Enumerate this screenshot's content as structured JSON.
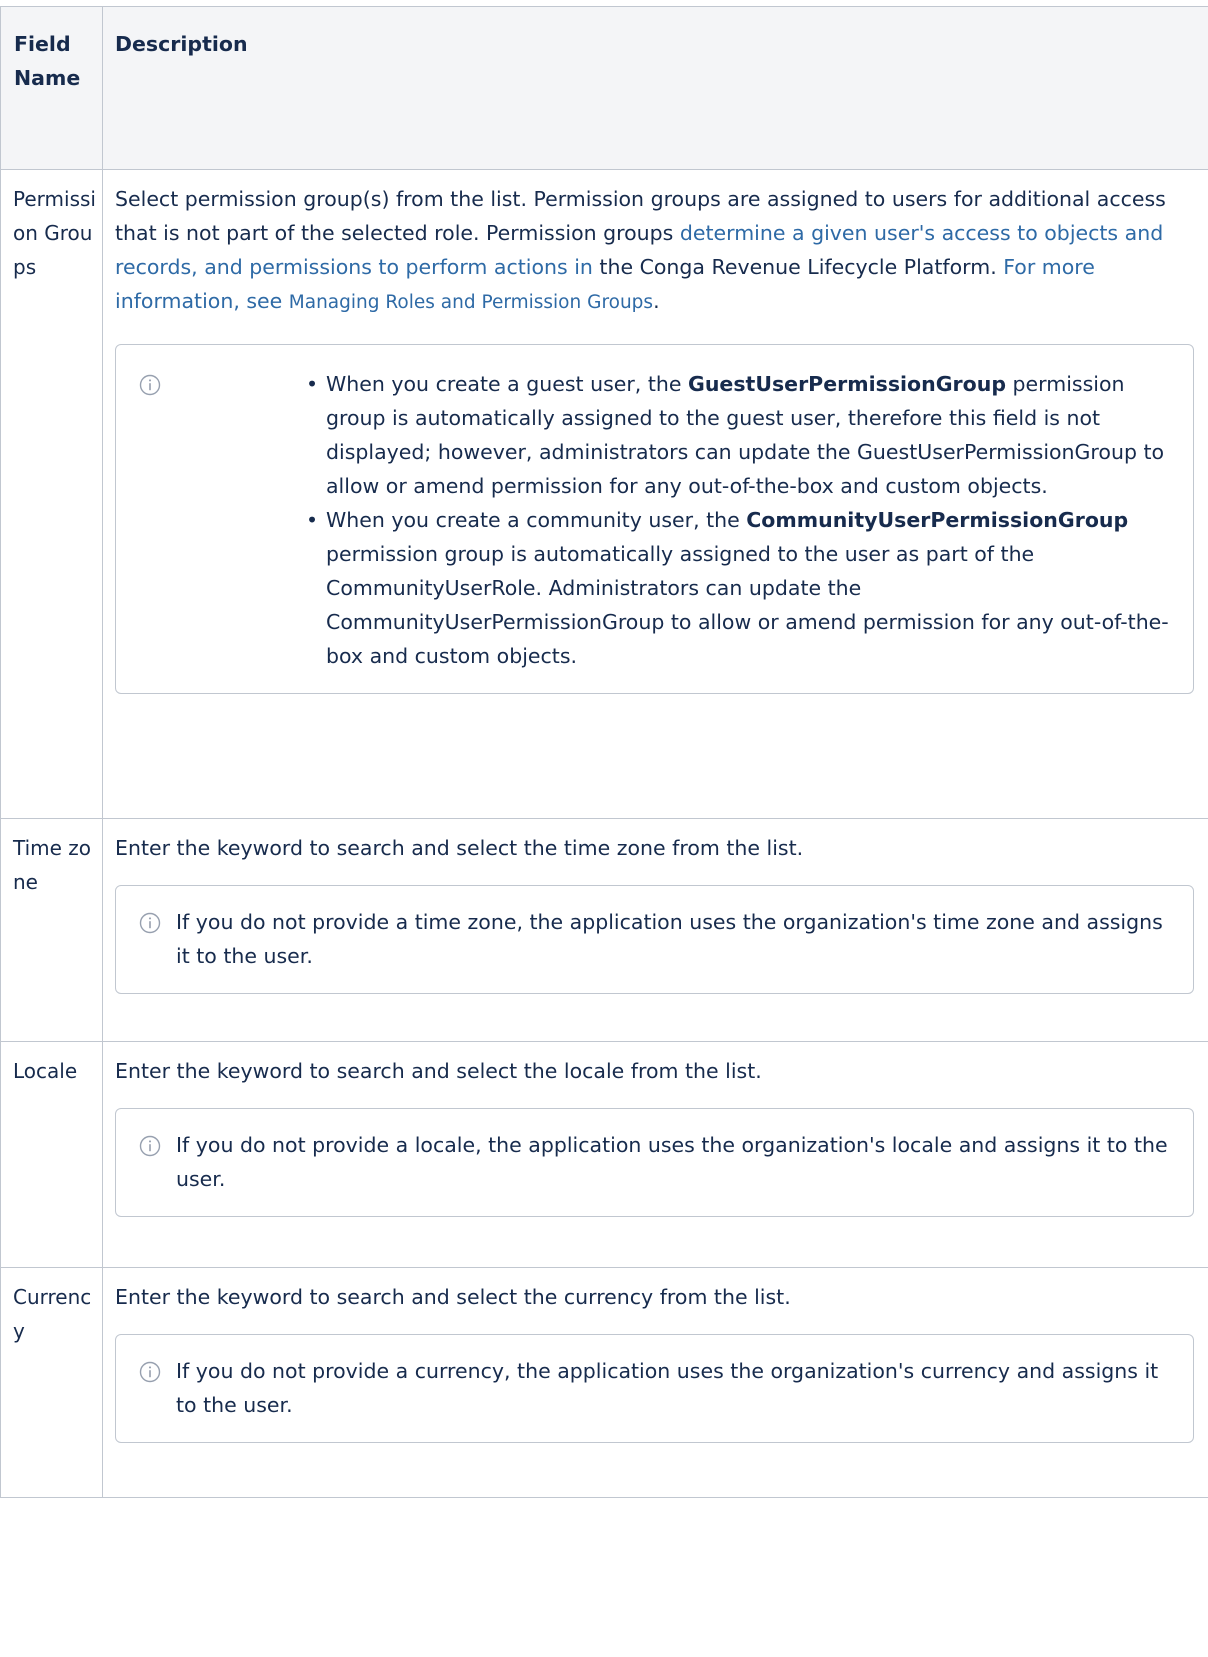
{
  "table": {
    "headers": [
      "Field Name",
      "Description"
    ],
    "rows": [
      {
        "field": "Permission Groups",
        "desc_part1": "Select permission group(s) from the list. Permission groups are assigned to users for additional access that is not part of the selected role. Permission groups ",
        "desc_link1": "determine a given user's access to objects and records, and permissions to perform actions in",
        "desc_part2": " the Conga Revenue Lifecycle Platform. ",
        "desc_link2": "For more information, see ",
        "desc_link3": "Managing Roles and Permission Groups",
        "desc_end": ".",
        "note_items": [
          {
            "pre": "When you create a guest user, the ",
            "bold": "GuestUserPermissionGroup",
            "post": " permission group is automatically assigned to the guest user, therefore this field is not displayed; however, administrators can update the GuestUserPermissionGroup to allow or amend permission for any out-of-the-box and custom objects."
          },
          {
            "pre": "When you create a community user, the ",
            "bold": "CommunityUserPermissionGroup",
            "post": " permission group is automatically assigned to the user as part of the CommunityUserRole. Administrators can update the CommunityUserPermissionGroup to allow or amend permission for any out-of-the-box and custom objects."
          }
        ]
      },
      {
        "field": "Time zone",
        "desc": "Enter the keyword to search and select the time zone from the list.",
        "note": "If you do not provide a time zone, the application uses the organization's time zone and assigns it to the user."
      },
      {
        "field": "Locale",
        "desc": "Enter the keyword to search and select the locale from the list.",
        "note": "If you do not provide a locale, the application uses the organization's locale and assigns it to the user."
      },
      {
        "field": "Currency",
        "desc": "Enter the keyword to search and select the currency from the list.",
        "note": "If you do not provide a currency, the application uses the organization's currency and assigns it to the user."
      }
    ]
  },
  "icons": {
    "note": "info-icon"
  },
  "colors": {
    "link": "#2e6aa6",
    "text": "#172b4d",
    "border": "#c1c7d0",
    "header_bg": "#f4f5f7"
  }
}
